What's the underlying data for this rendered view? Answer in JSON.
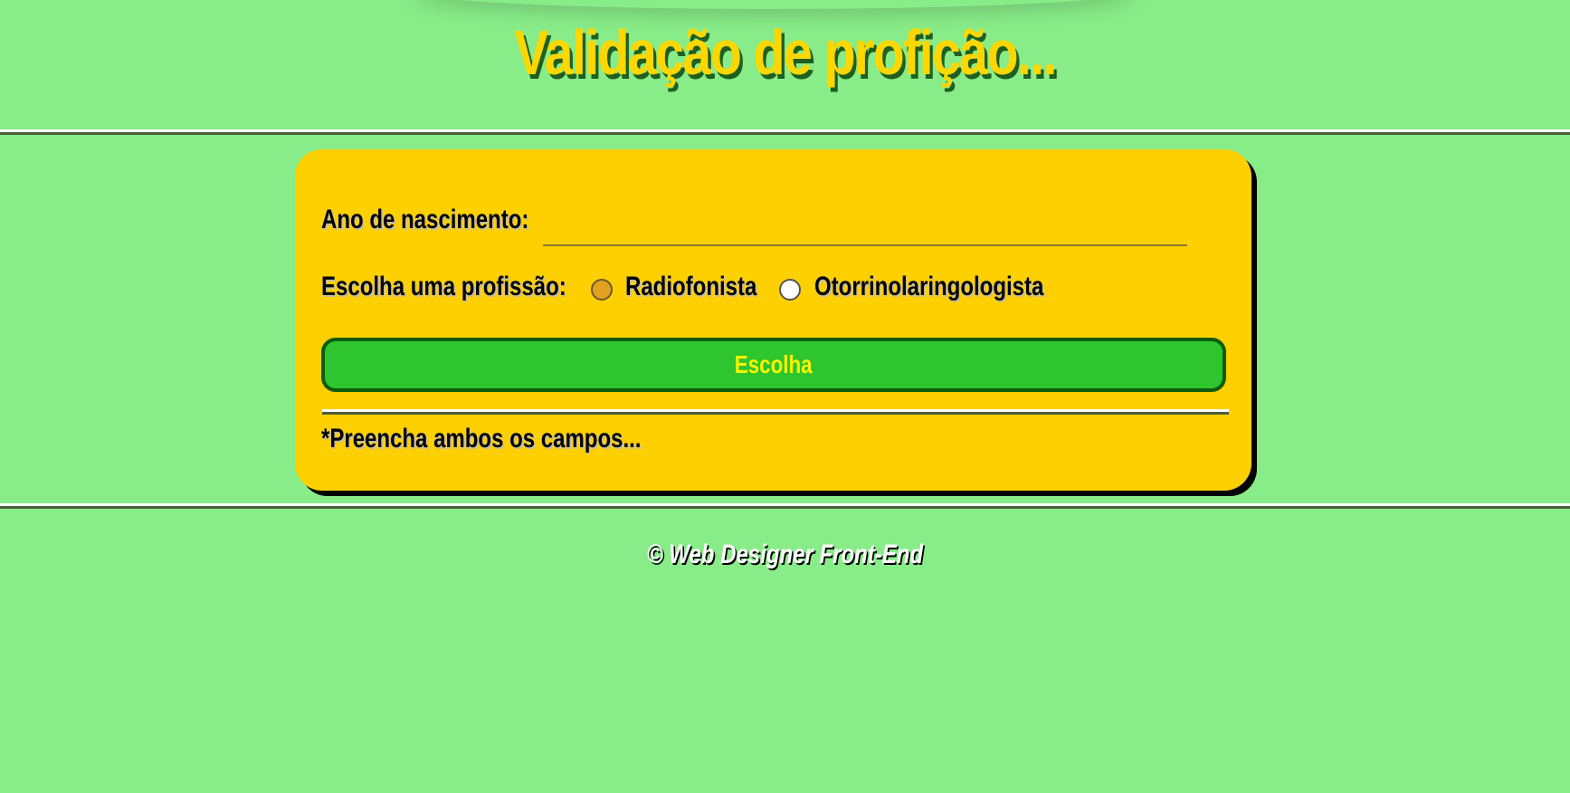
{
  "header": {
    "title": "Validação de profição..."
  },
  "form": {
    "year_label": "Ano de nascimento:",
    "year_value": "",
    "profession_label": "Escolha uma profissão:",
    "options": [
      {
        "label": "Radiofonista",
        "selected": true
      },
      {
        "label": "Otorrinolaringologista",
        "selected": false
      }
    ],
    "submit_label": "Escolha",
    "status_message": "*Preencha ambos os campos..."
  },
  "footer": {
    "text": "© Web Designer Front-End"
  },
  "colors": {
    "background": "#88ec88",
    "card": "#ffd000",
    "title": "#ffd700",
    "button": "#2ec52e",
    "button_text": "#f5f500"
  }
}
